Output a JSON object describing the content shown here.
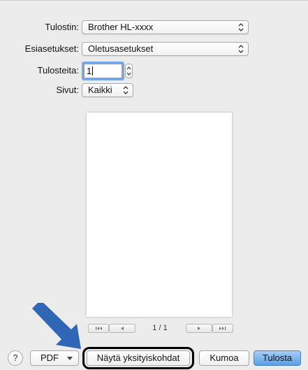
{
  "printer": {
    "label": "Tulostin:",
    "value": "Brother HL-xxxx"
  },
  "presets": {
    "label": "Esiasetukset:",
    "value": "Oletusasetukset"
  },
  "copies": {
    "label": "Tulosteita:",
    "value": "1"
  },
  "pages": {
    "label": "Sivut:",
    "value": "Kaikki"
  },
  "preview": {
    "page_indicator": "1 / 1"
  },
  "footer": {
    "help_label": "?",
    "pdf_label": "PDF",
    "show_details_label": "Näytä yksityiskohdat",
    "cancel_label": "Kumoa",
    "print_label": "Tulosta"
  },
  "colors": {
    "accent_blue": "#5d9ee6",
    "annotation_arrow": "#2f66b5",
    "focus_ring": "#7aa7e8"
  },
  "icons": [
    "updown-chevron-icon",
    "first-page-icon",
    "previous-page-icon",
    "next-page-icon",
    "last-page-icon",
    "help-icon",
    "dropdown-triangle-icon",
    "callout-arrow-icon"
  ]
}
